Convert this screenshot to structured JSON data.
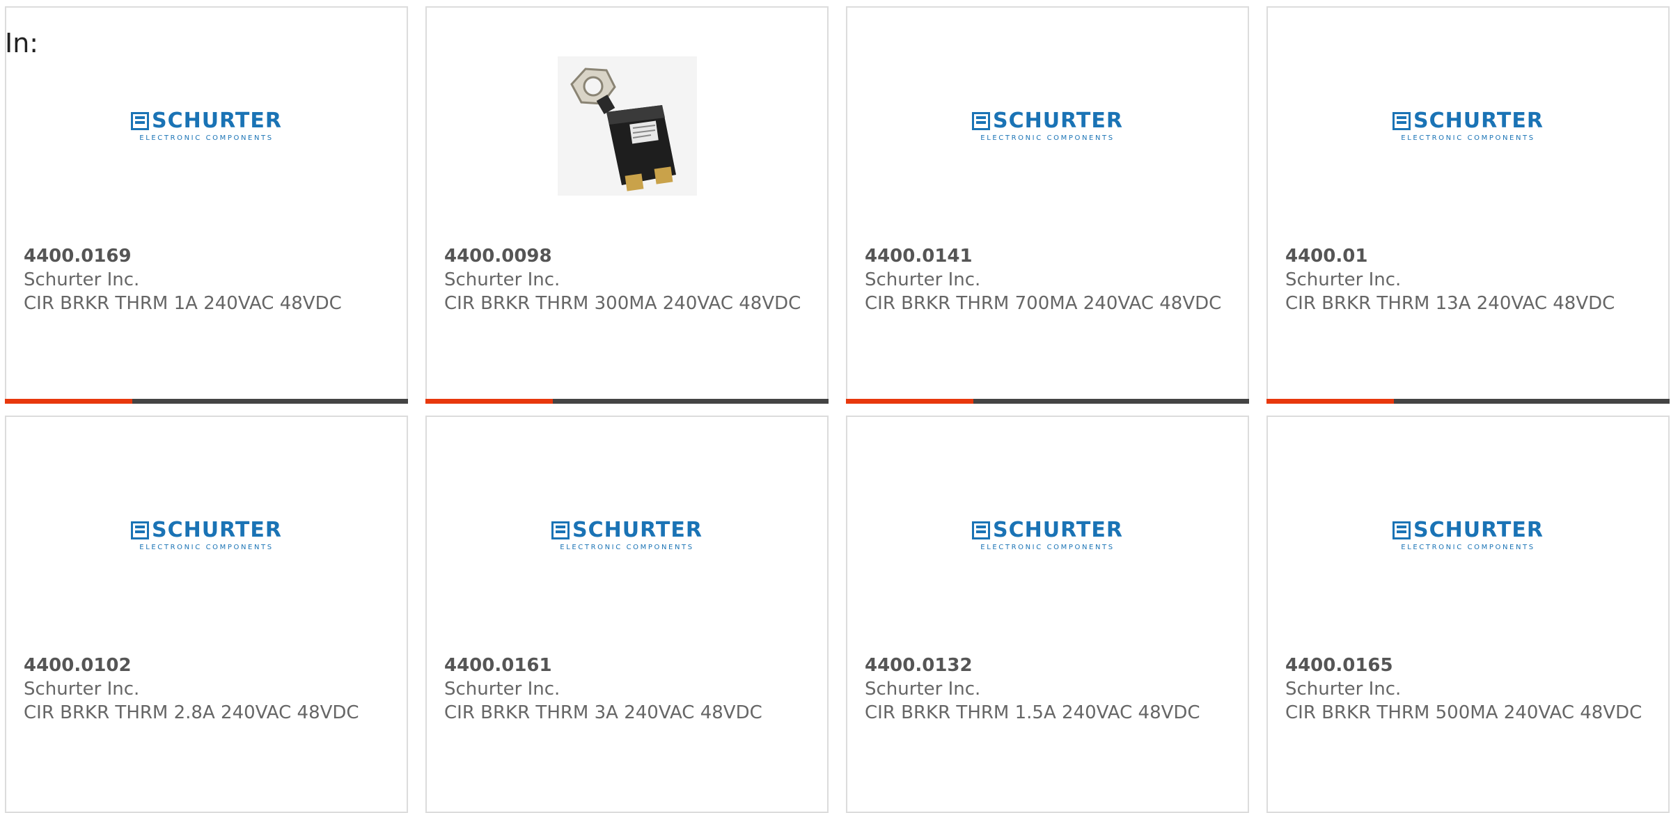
{
  "header": {
    "in_label": "In:"
  },
  "colors": {
    "accent": "#e8380d",
    "bar": "#444444",
    "brand": "#1a73b5"
  },
  "logo": {
    "word": "SCHURTER",
    "sub": "ELECTRONIC COMPONENTS"
  },
  "products": [
    {
      "part_number": "4400.0169",
      "manufacturer": "Schurter Inc.",
      "description": "CIR BRKR THRM 1A 240VAC 48VDC",
      "image": "schurter-logo"
    },
    {
      "part_number": "4400.0098",
      "manufacturer": "Schurter Inc.",
      "description": "CIR BRKR THRM 300MA 240VAC 48VDC",
      "image": "circuit-breaker-photo"
    },
    {
      "part_number": "4400.0141",
      "manufacturer": "Schurter Inc.",
      "description": "CIR BRKR THRM 700MA 240VAC 48VDC",
      "image": "schurter-logo"
    },
    {
      "part_number": "4400.01",
      "manufacturer": "Schurter Inc.",
      "description": "CIR BRKR THRM 13A 240VAC 48VDC",
      "image": "schurter-logo"
    },
    {
      "part_number": "4400.0102",
      "manufacturer": "Schurter Inc.",
      "description": "CIR BRKR THRM 2.8A 240VAC 48VDC",
      "image": "schurter-logo"
    },
    {
      "part_number": "4400.0161",
      "manufacturer": "Schurter Inc.",
      "description": "CIR BRKR THRM 3A 240VAC 48VDC",
      "image": "schurter-logo"
    },
    {
      "part_number": "4400.0132",
      "manufacturer": "Schurter Inc.",
      "description": "CIR BRKR THRM 1.5A 240VAC 48VDC",
      "image": "schurter-logo"
    },
    {
      "part_number": "4400.0165",
      "manufacturer": "Schurter Inc.",
      "description": "CIR BRKR THRM 500MA 240VAC 48VDC",
      "image": "schurter-logo"
    }
  ]
}
